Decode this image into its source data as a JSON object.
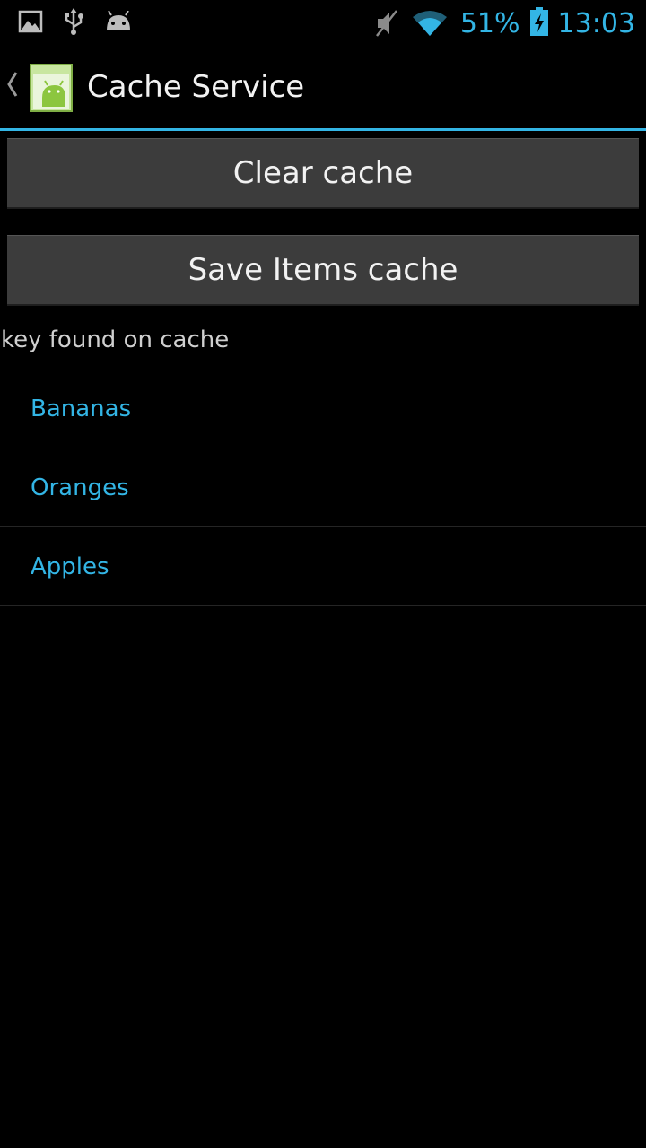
{
  "status_bar": {
    "icons_left": [
      "gallery-icon",
      "usb-icon",
      "android-debug-icon"
    ],
    "icons_right": [
      "mute-icon",
      "wifi-icon"
    ],
    "battery_percent": "51%",
    "time": "13:03",
    "accent_color": "#33b5e5"
  },
  "action_bar": {
    "title": "Cache Service",
    "divider_color": "#33b5e5"
  },
  "buttons": {
    "clear_label": "Clear cache",
    "save_label": "Save Items cache"
  },
  "caption": "key found on cache",
  "items": [
    {
      "label": "Bananas"
    },
    {
      "label": "Oranges"
    },
    {
      "label": "Apples"
    }
  ]
}
